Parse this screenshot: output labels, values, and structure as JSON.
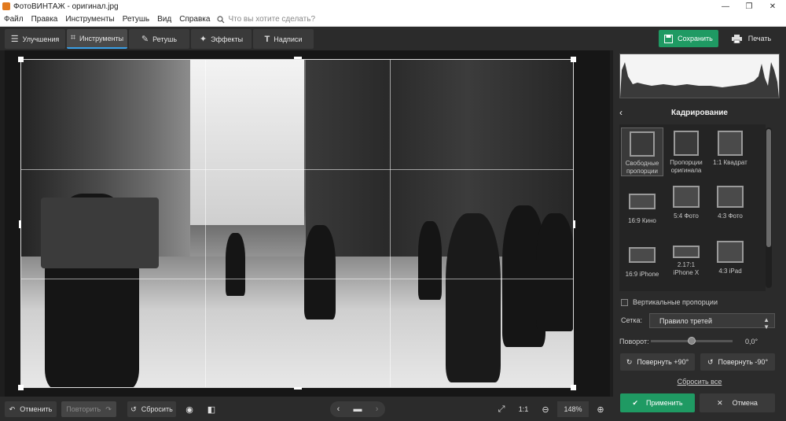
{
  "window": {
    "title": "ФотоВИНТАЖ - оригинал.jpg",
    "min": "—",
    "max": "❐",
    "close": "✕"
  },
  "menu": {
    "items": [
      "Файл",
      "Правка",
      "Инструменты",
      "Ретушь",
      "Вид",
      "Справка"
    ],
    "search_placeholder": "Что вы хотите сделать?"
  },
  "tabs": [
    {
      "label": "Улучшения",
      "icon": "sliders-icon"
    },
    {
      "label": "Инструменты",
      "icon": "crop-icon"
    },
    {
      "label": "Ретушь",
      "icon": "brush-icon"
    },
    {
      "label": "Эффекты",
      "icon": "magic-icon"
    },
    {
      "label": "Надписи",
      "icon": "text-icon"
    }
  ],
  "toolbar": {
    "save_label": "Сохранить",
    "print_label": "Печать"
  },
  "bottom": {
    "undo_label": "Отменить",
    "redo_label": "Повторить",
    "reset_label": "Сбросить",
    "ratio_label": "1:1",
    "zoom": "148%"
  },
  "panel": {
    "title": "Кадрирование",
    "presets": [
      {
        "label1": "Свободные",
        "label2": "пропорции"
      },
      {
        "label1": "Пропорции",
        "label2": "оригинала"
      },
      {
        "label1": "1:1 Квадрат",
        "label2": ""
      },
      {
        "label1": "16:9 Кино",
        "label2": ""
      },
      {
        "label1": "5:4 Фото",
        "label2": ""
      },
      {
        "label1": "4:3 Фото",
        "label2": ""
      },
      {
        "label1": "16:9 iPhone",
        "label2": ""
      },
      {
        "label1": "2.17:1",
        "label2": "iPhone X"
      },
      {
        "label1": "4:3 iPad",
        "label2": ""
      }
    ],
    "vertical_label": "Вертикальные пропорции",
    "grid_label": "Сетка:",
    "grid_value": "Правило третей",
    "rotation_label": "Поворот:",
    "rotation_value": "0,0°",
    "rotate_right": "Повернуть +90°",
    "rotate_left": "Повернуть -90°",
    "reset_all": "Сбросить все",
    "apply": "Применить",
    "cancel": "Отмена"
  },
  "colors": {
    "accent_green": "#1f9a63",
    "tab_highlight": "#3aa0e8"
  }
}
